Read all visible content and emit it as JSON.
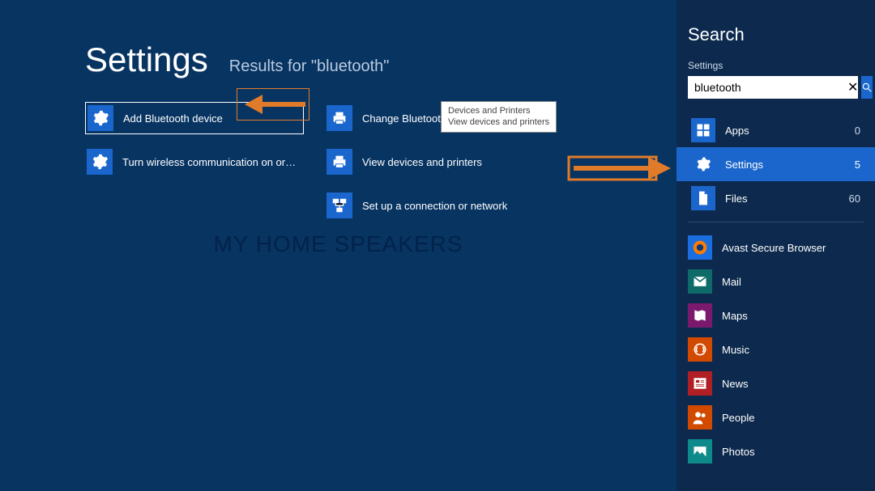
{
  "main": {
    "title": "Settings",
    "subtitle": "Results for \"bluetooth\"",
    "results_col1": [
      {
        "label": "Add Bluetooth device",
        "icon": "gear",
        "selected": true
      },
      {
        "label": "Turn wireless communication on or off",
        "icon": "gear",
        "selected": false
      }
    ],
    "results_col2": [
      {
        "label": "Change Bluetooth settings",
        "icon": "printer",
        "selected": false
      },
      {
        "label": "View devices and printers",
        "icon": "printer-alt",
        "selected": false
      },
      {
        "label": "Set up a connection or network",
        "icon": "network",
        "selected": false
      }
    ],
    "tooltip": {
      "line1": "Devices and Printers",
      "line2": "View devices and printers"
    },
    "watermark": "MY HOME SPEAKERS"
  },
  "search": {
    "heading": "Search",
    "scope_label": "Settings",
    "input_value": "bluetooth",
    "clear_symbol": "✕",
    "scopes": [
      {
        "name": "Apps",
        "count": "0",
        "icon": "apps",
        "bg": "#1a66cc"
      },
      {
        "name": "Settings",
        "count": "5",
        "icon": "gear",
        "bg": "#1a66cc",
        "active": true
      },
      {
        "name": "Files",
        "count": "60",
        "icon": "file",
        "bg": "#1a66cc"
      }
    ],
    "apps": [
      {
        "name": "Avast Secure Browser",
        "icon": "avast",
        "bg": "#1b6ee0"
      },
      {
        "name": "Mail",
        "icon": "mail",
        "bg": "#0f6a6a"
      },
      {
        "name": "Maps",
        "icon": "maps",
        "bg": "#7b1a6c"
      },
      {
        "name": "Music",
        "icon": "music",
        "bg": "#d24a00"
      },
      {
        "name": "News",
        "icon": "news",
        "bg": "#b01f23"
      },
      {
        "name": "People",
        "icon": "people",
        "bg": "#d24a00"
      },
      {
        "name": "Photos",
        "icon": "photos",
        "bg": "#0f8a8a"
      }
    ]
  }
}
